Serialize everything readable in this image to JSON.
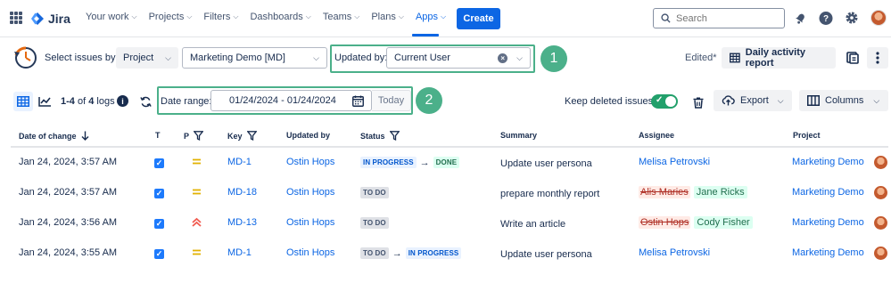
{
  "nav": {
    "product_name": "Jira",
    "items": [
      {
        "label": "Your work",
        "has_dropdown": true
      },
      {
        "label": "Projects",
        "has_dropdown": true
      },
      {
        "label": "Filters",
        "has_dropdown": true
      },
      {
        "label": "Dashboards",
        "has_dropdown": true
      },
      {
        "label": "Teams",
        "has_dropdown": true
      },
      {
        "label": "Plans",
        "has_dropdown": true
      },
      {
        "label": "Apps",
        "has_dropdown": true,
        "active": true
      }
    ],
    "create_label": "Create",
    "search_placeholder": "Search",
    "icons": [
      "bell-icon",
      "help-icon",
      "settings-icon"
    ]
  },
  "filters": {
    "select_by_label": "Select issues by:",
    "select_by_value": "Project",
    "project_value": "Marketing Demo [MD]",
    "updated_by_label": "Updated by:",
    "updated_by_value": "Current User",
    "callout_1": "1",
    "edited_label": "Edited*",
    "daily_report_label": "Daily activity report"
  },
  "toolbar": {
    "log_count_range": "1-4",
    "log_count_of": "of",
    "log_count_total": "4",
    "log_count_suffix": "logs",
    "date_range_label": "Date range:",
    "date_range_value": "01/24/2024 - 01/24/2024",
    "today_label": "Today",
    "callout_2": "2",
    "keep_deleted_label": "Keep deleted issues",
    "keep_deleted_on": true,
    "export_label": "Export",
    "columns_label": "Columns"
  },
  "table": {
    "headers": {
      "date": "Date of change",
      "t": "T",
      "p": "P",
      "key": "Key",
      "updated_by": "Updated by",
      "status": "Status",
      "summary": "Summary",
      "assignee": "Assignee",
      "project": "Project"
    },
    "rows": [
      {
        "date": "Jan 24, 2024, 3:57 AM",
        "priority": "medium",
        "key": "MD-1",
        "updated_by": "Ostin Hops",
        "status_from": "IN PROGRESS",
        "status_to": "DONE",
        "summary": "Update user persona",
        "assignee": "Melisa Petrovski",
        "project": "Marketing Demo"
      },
      {
        "date": "Jan 24, 2024, 3:57 AM",
        "priority": "medium",
        "key": "MD-18",
        "updated_by": "Ostin Hops",
        "status": "TO DO",
        "summary": "prepare monthly report",
        "assignee_old": "Alis Maries",
        "assignee_new": "Jane Ricks",
        "project": "Marketing Demo"
      },
      {
        "date": "Jan 24, 2024, 3:56 AM",
        "priority": "high",
        "key": "MD-13",
        "updated_by": "Ostin Hops",
        "status": "TO DO",
        "summary": "Write an article",
        "assignee_old": "Ostin Hops",
        "assignee_new": "Cody Fisher",
        "project": "Marketing Demo"
      },
      {
        "date": "Jan 24, 2024, 3:55 AM",
        "priority": "medium",
        "key": "MD-1",
        "updated_by": "Ostin Hops",
        "status_from": "TO DO",
        "status_to": "IN PROGRESS",
        "summary": "Update user persona",
        "assignee": "Melisa Petrovski",
        "project": "Marketing Demo"
      }
    ]
  },
  "colors": {
    "brand_blue": "#0c66e4",
    "callout_green": "#4bb08a",
    "toggle_green": "#22a06b",
    "priority_medium": "#e2b203",
    "priority_high": "#f15b50"
  }
}
